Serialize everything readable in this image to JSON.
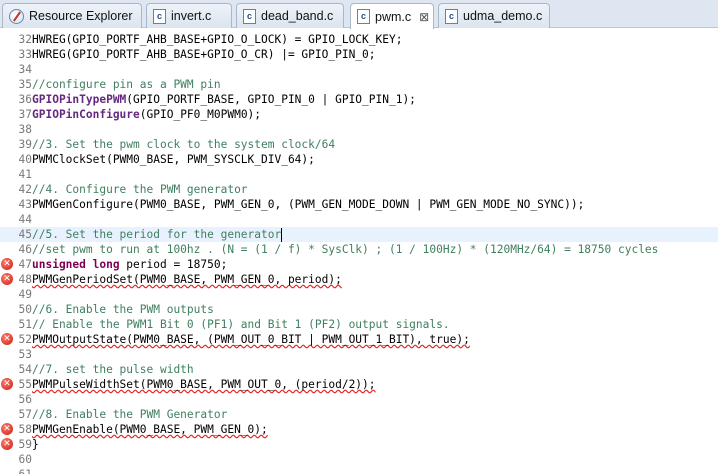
{
  "tabs": [
    {
      "label": "Resource Explorer",
      "icon": "resource-explorer-icon",
      "active": false
    },
    {
      "label": "invert.c",
      "icon": "c-file-icon",
      "active": false
    },
    {
      "label": "dead_band.c",
      "icon": "c-file-icon",
      "active": false
    },
    {
      "label": "pwm.c",
      "icon": "c-file-icon",
      "active": true,
      "close": "⊠"
    },
    {
      "label": "udma_demo.c",
      "icon": "c-file-icon",
      "active": false
    }
  ],
  "editor": {
    "lines": [
      {
        "n": "32",
        "seg": [
          [
            "p",
            "HWREG(GPIO_PORTF_AHB_BASE+GPIO_O_LOCK) = GPIO_LOCK_KEY;"
          ]
        ]
      },
      {
        "n": "33",
        "seg": [
          [
            "p",
            "HWREG(GPIO_PORTF_AHB_BASE+GPIO_O_CR) |= GPIO_PIN_0;"
          ]
        ]
      },
      {
        "n": "34",
        "seg": []
      },
      {
        "n": "35",
        "seg": [
          [
            "c",
            "//configure pin as a PWM pin"
          ]
        ]
      },
      {
        "n": "36",
        "seg": [
          [
            "f",
            "GPIOPinTypePWM"
          ],
          [
            "p",
            "(GPIO_PORTF_BASE, GPIO_PIN_0 | GPIO_PIN_1);"
          ]
        ]
      },
      {
        "n": "37",
        "seg": [
          [
            "f",
            "GPIOPinConfigure"
          ],
          [
            "p",
            "(GPIO_PF0_M0PWM0);"
          ]
        ]
      },
      {
        "n": "38",
        "seg": []
      },
      {
        "n": "39",
        "seg": [
          [
            "c",
            "//3. Set the pwm clock to the system clock/64"
          ]
        ]
      },
      {
        "n": "40",
        "seg": [
          [
            "p",
            "PWMClockSet(PWM0_BASE, PWM_SYSCLK_DIV_64);"
          ]
        ]
      },
      {
        "n": "41",
        "seg": []
      },
      {
        "n": "42",
        "seg": [
          [
            "c",
            "//4. Configure the PWM generator"
          ]
        ]
      },
      {
        "n": "43",
        "seg": [
          [
            "p",
            "PWMGenConfigure(PWM0_BASE, PWM_GEN_0, (PWM_GEN_MODE_DOWN | PWM_GEN_MODE_NO_SYNC));"
          ]
        ]
      },
      {
        "n": "44",
        "seg": []
      },
      {
        "n": "45",
        "seg": [
          [
            "c",
            "//5. Set the period for the generator"
          ]
        ],
        "current": true
      },
      {
        "n": "46",
        "seg": [
          [
            "c",
            "//set pwm to run at 100hz . (N = (1 / f) * SysClk) ; (1 / 100Hz) * (120MHz/64) = 18750 cycles"
          ]
        ]
      },
      {
        "n": "47",
        "seg": [
          [
            "k",
            "unsigned long"
          ],
          [
            "p",
            " period = 18750;"
          ]
        ],
        "error": true
      },
      {
        "n": "48",
        "seg": [
          [
            "e",
            "PWMGenPeriodSet(PWM0_BASE, PWM_GEN_0, period);"
          ]
        ],
        "error": true
      },
      {
        "n": "49",
        "seg": []
      },
      {
        "n": "50",
        "seg": [
          [
            "c",
            "//6. Enable the PWM outputs"
          ]
        ]
      },
      {
        "n": "51",
        "seg": [
          [
            "c",
            "// Enable the PWM1 Bit 0 (PF1) and Bit 1 (PF2) output signals."
          ]
        ]
      },
      {
        "n": "52",
        "seg": [
          [
            "e",
            "PWMOutputState(PWM0_BASE, (PWM_OUT_0_BIT | PWM_OUT_1_BIT), true);"
          ]
        ],
        "error": true
      },
      {
        "n": "53",
        "seg": []
      },
      {
        "n": "54",
        "seg": [
          [
            "c",
            "//7. set the pulse width"
          ]
        ]
      },
      {
        "n": "55",
        "seg": [
          [
            "e",
            "PWMPulseWidthSet(PWM0_BASE, PWM_OUT_0, (period/2));"
          ]
        ],
        "error": true
      },
      {
        "n": "56",
        "seg": []
      },
      {
        "n": "57",
        "seg": [
          [
            "c",
            "//8. Enable the PWM Generator"
          ]
        ]
      },
      {
        "n": "58",
        "seg": [
          [
            "e",
            "PWMGenEnable(PWM0_BASE, PWM_GEN_0);"
          ]
        ],
        "error": true
      },
      {
        "n": "59",
        "seg": [
          [
            "p",
            "}"
          ]
        ],
        "error": true
      },
      {
        "n": "60",
        "seg": []
      },
      {
        "n": "61",
        "seg": []
      }
    ]
  }
}
